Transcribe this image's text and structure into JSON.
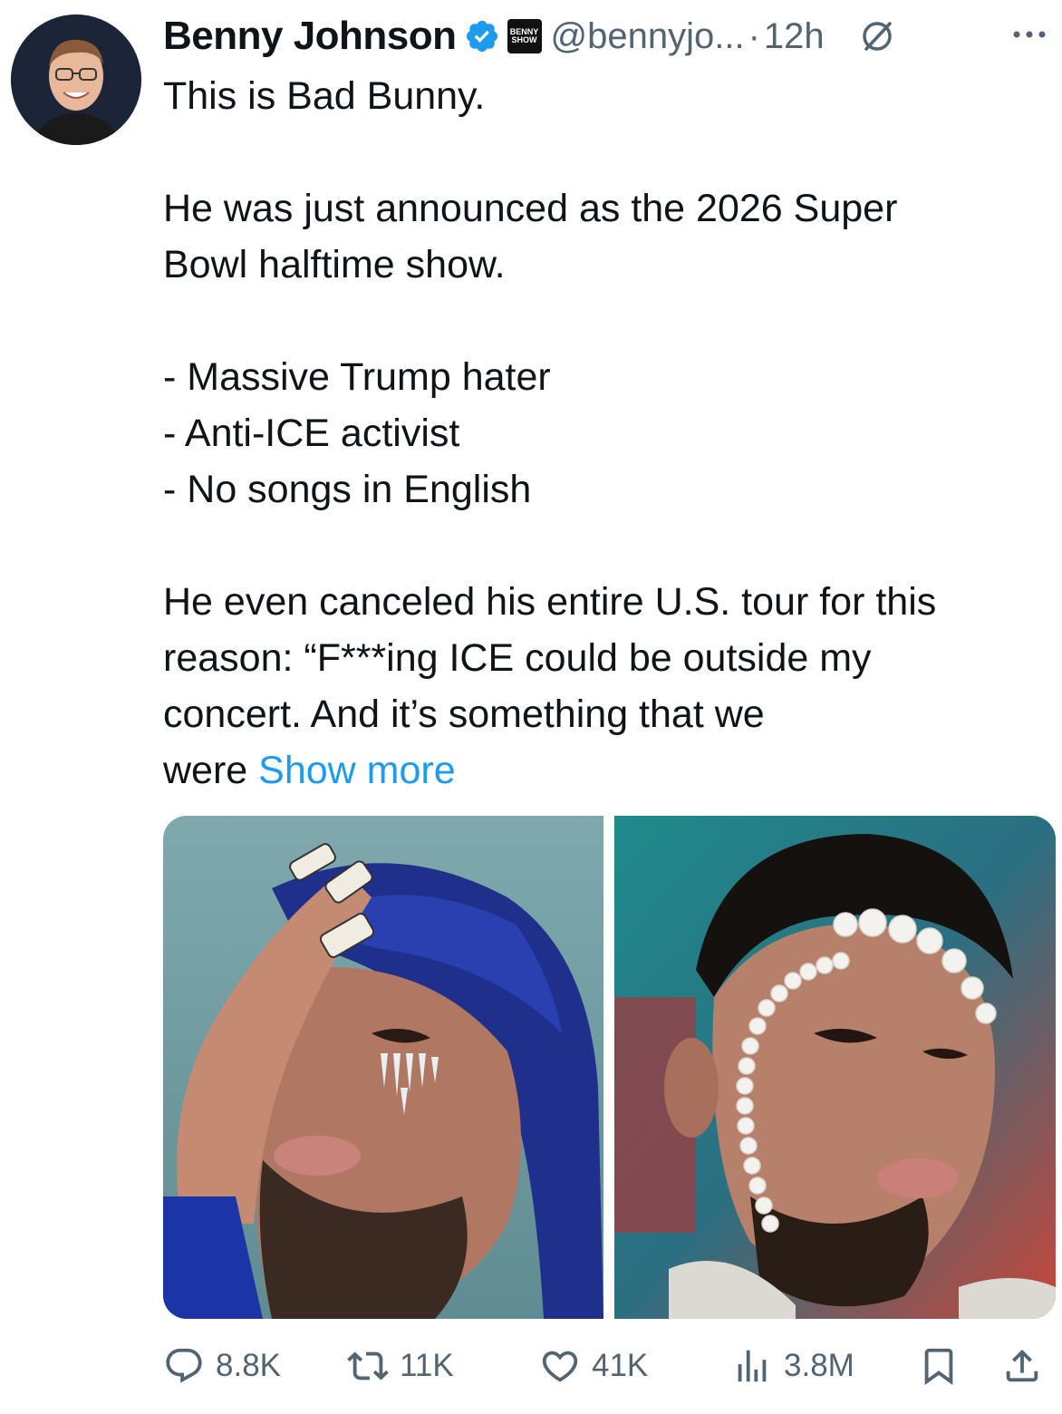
{
  "author": {
    "name": "Benny Johnson",
    "handle": "@bennyjo...",
    "separator": "·",
    "time": "12h",
    "affiliate_badge_line1": "BENNY",
    "affiliate_badge_line2": "SHOW"
  },
  "tweet": {
    "line1": "This is Bad Bunny.",
    "para2_line1": "He was just announced as the 2026 Super",
    "para2_line2": "Bowl halftime show.",
    "bullet1": "- Massive Trump hater",
    "bullet2": "- Anti-ICE activist",
    "bullet3": "- No songs in English",
    "para4_line1": "He even canceled his entire U.S. tour for this",
    "para4_line2": "reason: “F***ing ICE could be outside my",
    "para4_line3": "concert. And it’s something that we",
    "para4_line4": "were",
    "show_more": "Show more"
  },
  "actions": {
    "replies": "8.8K",
    "reposts": "11K",
    "likes": "41K",
    "views": "3.8M"
  },
  "colors": {
    "accent": "#1d9bf0",
    "text": "#0f1419",
    "secondary": "#536471"
  },
  "icons": [
    "verified-badge-icon",
    "grok-icon",
    "more-icon",
    "reply-icon",
    "repost-icon",
    "like-icon",
    "views-icon",
    "bookmark-icon",
    "share-icon"
  ]
}
